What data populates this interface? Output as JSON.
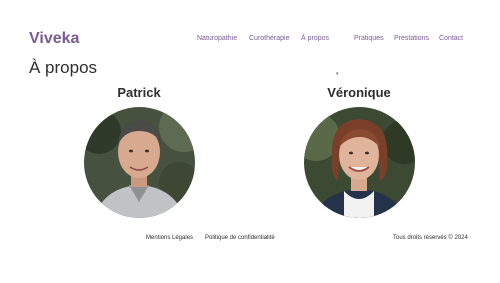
{
  "brand": "Viveka",
  "nav": {
    "items": [
      "Naturopathie",
      "Curothérapie",
      "À propos",
      "Pratiques",
      "Prestations",
      "Contact"
    ],
    "caret": "▾"
  },
  "page": {
    "title": "À propos"
  },
  "people": [
    {
      "name": "Patrick"
    },
    {
      "name": "Véronique"
    }
  ],
  "footer": {
    "legal": "Mentions Légales",
    "privacy": "Politique de confidentialité",
    "rights": "Tous droits réservés © 2024"
  },
  "colors": {
    "accent": "#7a5c94",
    "text": "#2e2e2e"
  }
}
